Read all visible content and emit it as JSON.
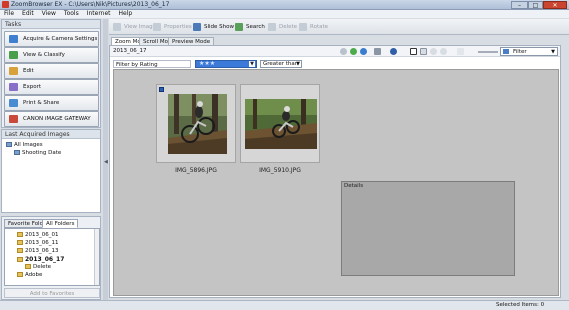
{
  "window": {
    "title": "ZoomBrowser EX - C:\\Users\\Nik\\Pictures\\2013_06_17"
  },
  "menu": [
    "File",
    "Edit",
    "View",
    "Tools",
    "Internet",
    "Help"
  ],
  "tasks": {
    "header": "Tasks",
    "items": [
      {
        "label": "Acquire & Camera Settings",
        "color": "#3f7fcf"
      },
      {
        "label": "View & Classify",
        "color": "#4aa04a"
      },
      {
        "label": "Edit",
        "color": "#d8a23a"
      },
      {
        "label": "Export",
        "color": "#8a6fc9"
      },
      {
        "label": "Print & Share",
        "color": "#4b8bd1"
      },
      {
        "label": "CANON iMAGE GATEWAY",
        "color": "#c94a3a"
      }
    ]
  },
  "acquired": {
    "header": "Last Acquired Images",
    "items": [
      "All Images",
      "Shooting Date"
    ]
  },
  "folders": {
    "tabs": [
      "Favorite Folders",
      "All Folders"
    ],
    "items": [
      "2013_06_01",
      "2013_06_11",
      "2013_06_13",
      "2013_06_17",
      "Delete",
      "Adobe"
    ],
    "add_favorites": "Add to Favorites"
  },
  "toolbar": {
    "view_image": "View Image",
    "properties": "Properties",
    "slide_show": "Slide Show",
    "search": "Search",
    "delete": "Delete",
    "rotate": "Rotate"
  },
  "view_tabs": [
    "Zoom Mode",
    "Scroll Mode",
    "Preview Mode"
  ],
  "main": {
    "folder": "2013_06_17",
    "filter_label": "Filter by Rating",
    "rating": "★★★",
    "compare": "Greater than",
    "filter_button": "Filter",
    "details_label": "Details",
    "thumbnails": [
      "IMG_5896.JPG",
      "IMG_5910.JPG"
    ]
  },
  "status": {
    "selected": "Selected Items: 0"
  }
}
